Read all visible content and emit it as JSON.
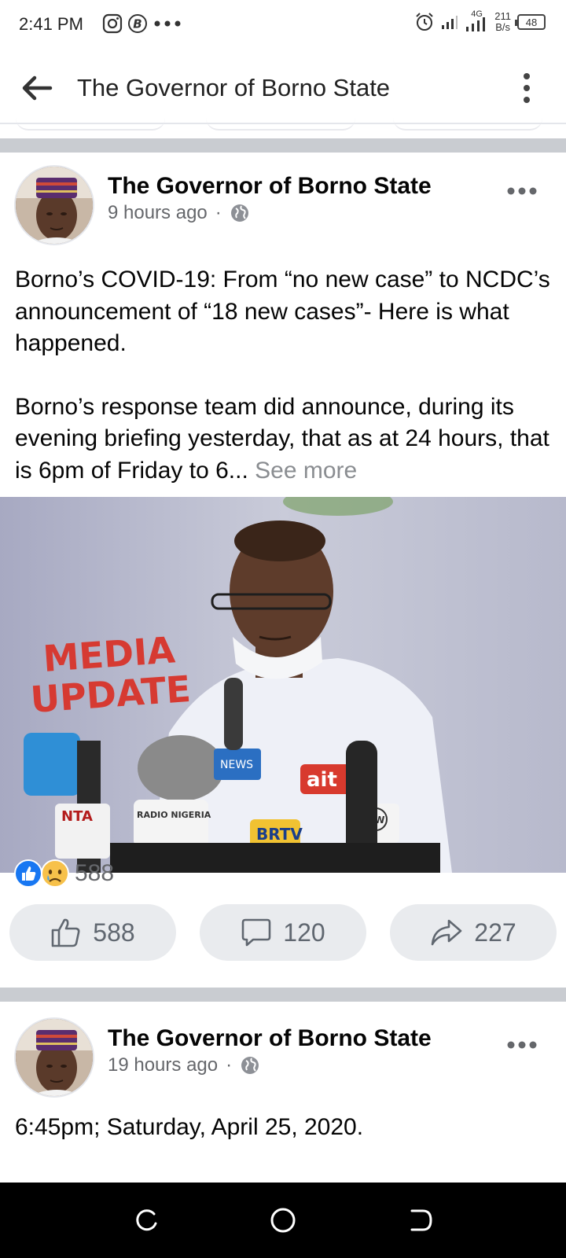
{
  "status_bar": {
    "time": "2:41 PM",
    "network_type": "4G",
    "net_speed_value": "211",
    "net_speed_unit": "B/s",
    "battery": "48"
  },
  "app_bar": {
    "title": "The Governor of Borno State"
  },
  "posts": [
    {
      "author": "The Governor of Borno State",
      "time": "9 hours ago",
      "paragraphs": [
        "Borno’s COVID-19: From “no new case” to NCDC’s announcement of “18 new cases”- Here is what happened.",
        "Borno’s response team did announce, during its evening briefing yesterday, that as at 24 hours, that is 6pm of Friday to 6..."
      ],
      "see_more": "See more",
      "photo": {
        "backdrop_lines": [
          "MEDIA",
          "UPDATE"
        ],
        "mic_labels": [
          "NTA",
          "RADIO NIGERIA",
          "NEWS",
          "ait",
          "BRTV",
          "FW"
        ]
      },
      "reaction_count": "588",
      "actions": {
        "like": "588",
        "comment": "120",
        "share": "227"
      }
    },
    {
      "author": "The Governor of Borno State",
      "time": "19 hours ago",
      "text": "6:45pm; Saturday, April 25, 2020."
    }
  ],
  "colors": {
    "brand_blue": "#1877f2",
    "secondary_text": "#65676b",
    "button_bg": "#e9ebee",
    "divider": "#c9ccd1"
  }
}
